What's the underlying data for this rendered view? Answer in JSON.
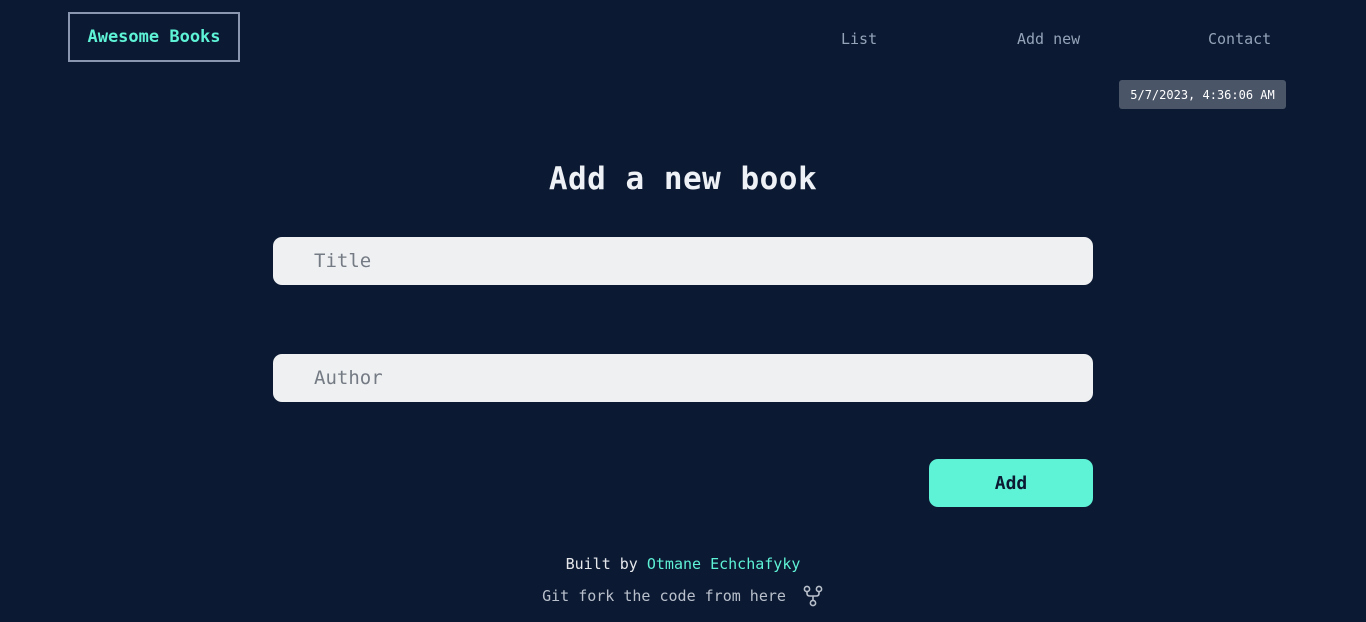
{
  "header": {
    "logo": "Awesome Books",
    "nav": {
      "list": "List",
      "add_new": "Add new",
      "contact": "Contact"
    },
    "datetime": "5/7/2023, 4:36:06 AM"
  },
  "main": {
    "heading": "Add a new book",
    "title_input": {
      "placeholder": "Title",
      "value": ""
    },
    "author_input": {
      "placeholder": "Author",
      "value": ""
    },
    "add_button": "Add"
  },
  "footer": {
    "built_by": "Built by",
    "author_name": "Otmane Echchafyky",
    "git_text": "Git fork the code from here",
    "fork_icon": "git-fork-icon"
  },
  "colors": {
    "background": "#0b1932",
    "accent": "#5ef2d6",
    "input_bg": "#eff0f2",
    "nav_text": "#94a3b8",
    "datetime_bg": "#4a5568"
  }
}
